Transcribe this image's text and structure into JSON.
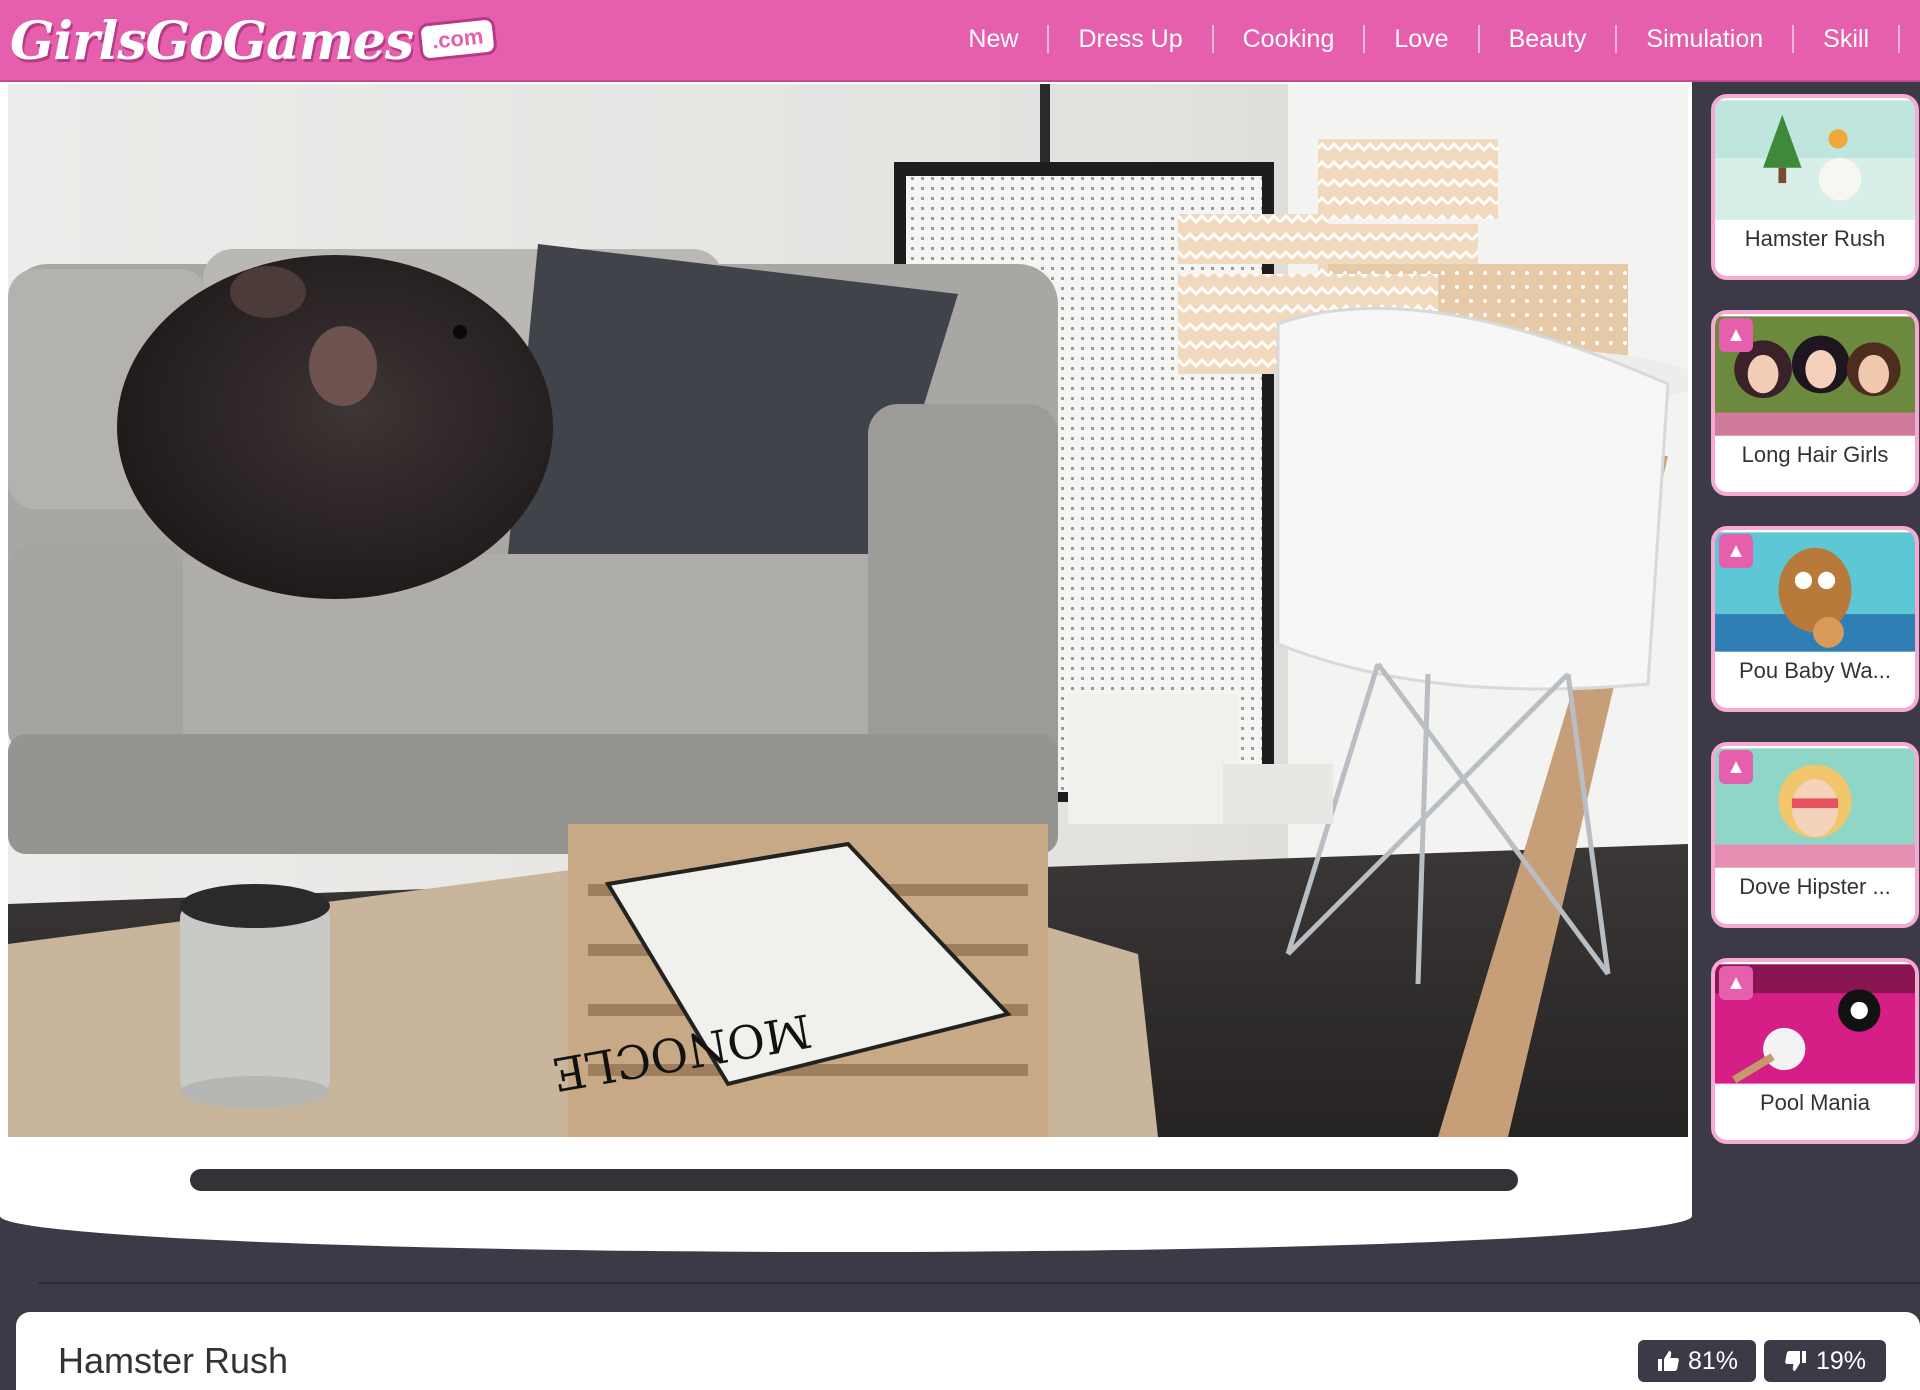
{
  "header": {
    "logo_text": "GirlsGoGames",
    "logo_suffix": ".com",
    "nav": [
      "New",
      "Dress Up",
      "Cooking",
      "Love",
      "Beauty",
      "Simulation",
      "Skill"
    ]
  },
  "game": {
    "title": "Hamster Rush",
    "likes": "81%",
    "dislikes": "19%",
    "magazine_title": "MONOCLE"
  },
  "sidebar": {
    "games": [
      {
        "title": "Hamster Rush",
        "hot": false
      },
      {
        "title": "Long Hair Girls",
        "hot": true
      },
      {
        "title": "Pou Baby Wa...",
        "hot": true
      },
      {
        "title": "Dove Hipster ...",
        "hot": true
      },
      {
        "title": "Pool Mania",
        "hot": true
      }
    ]
  },
  "colors": {
    "brand_pink": "#e55fad",
    "dark": "#3d3a47",
    "card_border": "#f6a9d1"
  },
  "icons": {
    "like": "thumbs-up-icon",
    "dislike": "thumbs-down-icon",
    "hot": "flame-icon"
  }
}
